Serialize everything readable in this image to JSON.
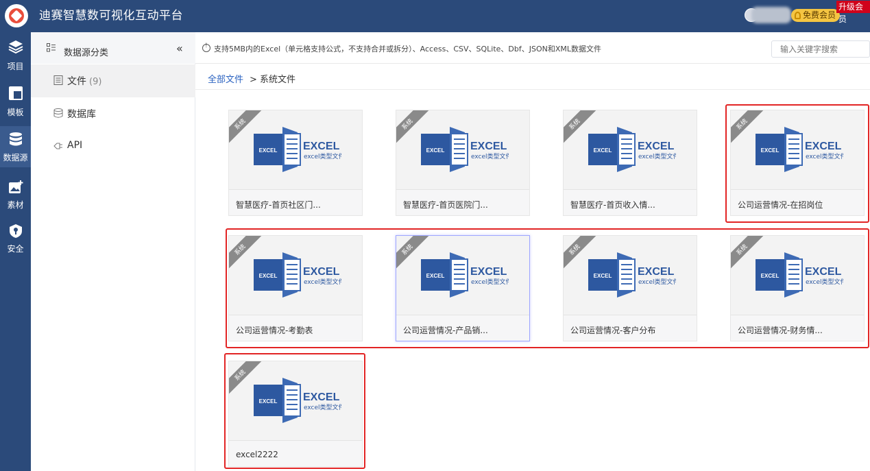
{
  "header": {
    "app_title": "迪赛智慧数可视化互动平台",
    "free_badge": "免费会员",
    "upgrade_badge": "升级会员"
  },
  "leftnav": [
    {
      "label": "项目",
      "icon": "layers-icon"
    },
    {
      "label": "模板",
      "icon": "template-icon"
    },
    {
      "label": "数据源",
      "icon": "database-icon"
    },
    {
      "label": "素材",
      "icon": "image-add-icon"
    },
    {
      "label": "安全",
      "icon": "shield-icon"
    }
  ],
  "sidebar": {
    "title": "数据源分类",
    "collapse": "«",
    "items": [
      {
        "label": "文件",
        "count": "(9)",
        "icon": "file-icon"
      },
      {
        "label": "数据库",
        "count": "",
        "icon": "database-icon"
      },
      {
        "label": "API",
        "count": "",
        "icon": "api-icon"
      }
    ]
  },
  "notice": "支持5MB内的Excel（单元格支持公式，不支持合并或拆分）、Access、CSV、SQLite、Dbf、JSON和XML数据文件",
  "search_placeholder": "输入关键字搜索",
  "breadcrumb": {
    "root": "全部文件",
    "current": "> 系统文件"
  },
  "excel_thumb": {
    "tag": "系统",
    "badge": "EXCEL",
    "title": "EXCEL",
    "subtitle": "excel类型文件"
  },
  "files": [
    "智慧医疗-首页社区门...",
    "智慧医疗-首页医院门...",
    "智慧医疗-首页收入情...",
    "公司运营情况-在招岗位",
    "公司运营情况-考勤表",
    "公司运营情况-产品销...",
    "公司运营情况-客户分布",
    "公司运营情况-财务情...",
    "excel2222"
  ]
}
